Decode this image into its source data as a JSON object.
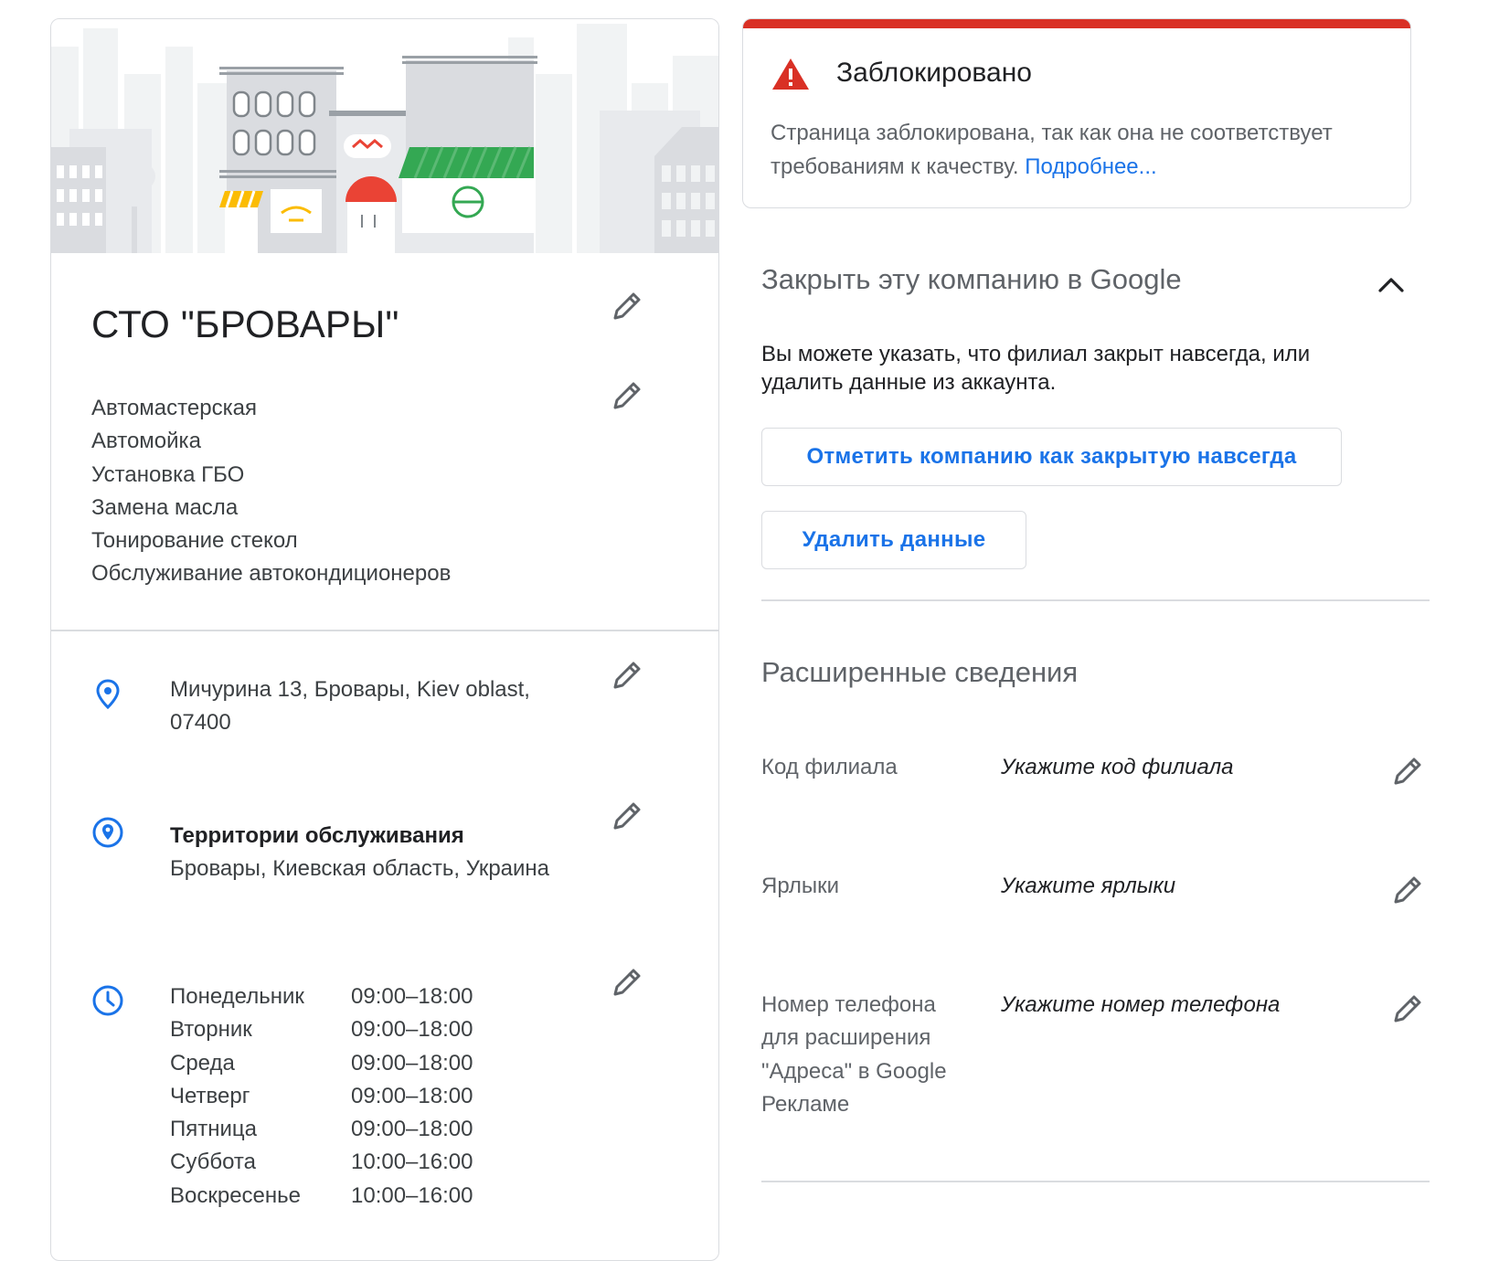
{
  "business": {
    "name": "СТО \"БРОВАРЫ\"",
    "categories": [
      "Автомастерская",
      "Автомойка",
      "Установка ГБО",
      "Замена масла",
      "Тонирование стекол",
      "Обслуживание автокондиционеров"
    ],
    "address_line1": "Мичурина 13, Бровары, Kiev oblast,",
    "address_line2": "07400",
    "service_areas": {
      "title": "Территории обслуживания",
      "value": "Бровары, Киевская область, Украина"
    },
    "hours": [
      {
        "day": "Понедельник",
        "time": "09:00–18:00"
      },
      {
        "day": "Вторник",
        "time": "09:00–18:00"
      },
      {
        "day": "Среда",
        "time": "09:00–18:00"
      },
      {
        "day": "Четверг",
        "time": "09:00–18:00"
      },
      {
        "day": "Пятница",
        "time": "09:00–18:00"
      },
      {
        "day": "Суббота",
        "time": "10:00–16:00"
      },
      {
        "day": "Воскресенье",
        "time": "10:00–16:00"
      }
    ]
  },
  "blocked": {
    "title": "Заблокировано",
    "description": "Страница заблокирована, так как она не соответствует требованиям к качеству.",
    "link": "Подробнее..."
  },
  "close_section": {
    "title": "Закрыть эту компанию в Google",
    "description": "Вы можете указать, что филиал закрыт навсегда, или удалить данные из аккаунта.",
    "mark_closed_label": "Отметить компанию как закрытую навсегда",
    "delete_label": "Удалить данные"
  },
  "advanced": {
    "title": "Расширенные сведения",
    "fields": [
      {
        "label": "Код филиала",
        "value": "Укажите код филиала"
      },
      {
        "label": "Ярлыки",
        "value": "Укажите ярлыки"
      },
      {
        "label": "Номер телефона для расширения \"Адреса\" в Google Рекламе",
        "value": "Укажите номер телефона"
      }
    ]
  },
  "icons": {
    "edit": "pencil-icon",
    "address": "map-pin-icon",
    "service_area": "service-area-pin-icon",
    "hours": "clock-icon",
    "blocked": "warning-icon",
    "collapse": "chevron-up-icon"
  },
  "colors": {
    "accent_blue": "#1a73e8",
    "alert_red": "#d93025",
    "text_primary": "#202124",
    "text_secondary": "#5f6368",
    "border": "#dadce0"
  }
}
